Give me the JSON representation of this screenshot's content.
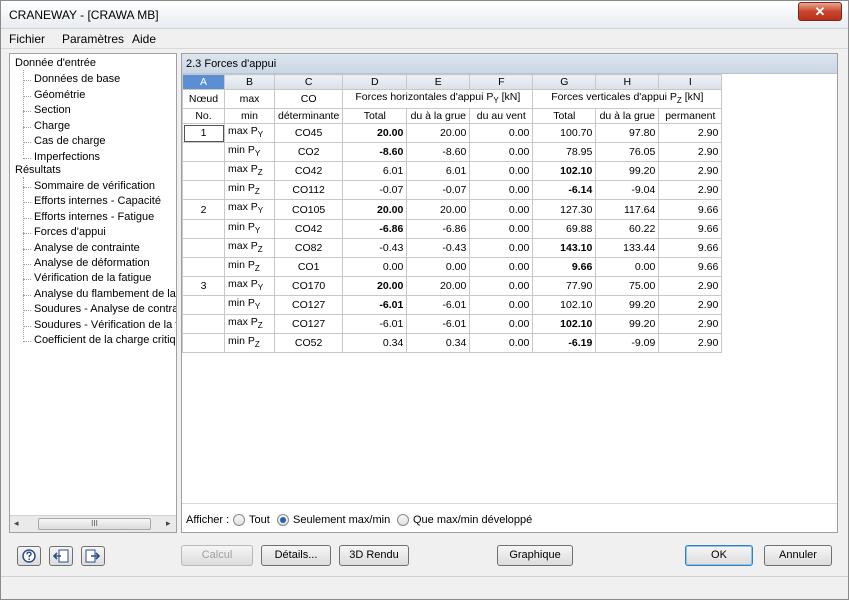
{
  "window": {
    "title": "CRANEWAY - [CRAWA MB]",
    "close_glyph": "✕"
  },
  "menu": [
    "Fichier",
    "Paramètres",
    "Aide"
  ],
  "nav": {
    "input_root": "Donnée d'entrée",
    "input_items": [
      "Données de base",
      "Géométrie",
      "Section",
      "Charge",
      "Cas de charge",
      "Imperfections"
    ],
    "results_root": "Résultats",
    "result_items": [
      "Sommaire de vérification",
      "Efforts internes - Capacité",
      "Efforts internes - Fatigue",
      "Forces d'appui",
      "Analyse de contrainte",
      "Analyse de déformation",
      "Vérification de la fatigue",
      "Analyse du flambement de la pl",
      "Soudures - Analyse de contrain",
      "Soudures - Vérification de la fat",
      "Coefficient de la charge critique"
    ],
    "scroll_left": "◂",
    "scroll_right": "▸",
    "scroll_grip": "III"
  },
  "section": {
    "title": "2.3 Forces d'appui"
  },
  "table": {
    "letters": [
      "A",
      "B",
      "C",
      "D",
      "E",
      "F",
      "G",
      "H",
      "I"
    ],
    "header1": {
      "node": "Nœud",
      "maxmin": "max",
      "co": "CO",
      "horiz": "Forces horizontales d'appui P",
      "horiz_sub": "Y",
      "horiz_unit": " [kN]",
      "vert": "Forces verticales d'appui P",
      "vert_sub": "Z",
      "vert_unit": " [kN]"
    },
    "header2": {
      "node": "No.",
      "maxmin": "min",
      "co": "déterminante",
      "d": "Total",
      "e": "du à la grue",
      "f": "du au vent",
      "g": "Total",
      "h": "du à la grue",
      "i": "permanent"
    },
    "rows": [
      {
        "node": "1",
        "label": "max P",
        "sub": "Y",
        "co": "CO45",
        "d": "20.00",
        "e": "20.00",
        "f": "0.00",
        "g": "100.70",
        "h": "97.80",
        "i": "2.90"
      },
      {
        "node": "",
        "label": "min P",
        "sub": "Y",
        "co": "CO2",
        "d": "-8.60",
        "e": "-8.60",
        "f": "0.00",
        "g": "78.95",
        "h": "76.05",
        "i": "2.90"
      },
      {
        "node": "",
        "label": "max P",
        "sub": "Z",
        "co": "CO42",
        "d": "6.01",
        "e": "6.01",
        "f": "0.00",
        "g": "102.10",
        "h": "99.20",
        "i": "2.90"
      },
      {
        "node": "",
        "label": "min P",
        "sub": "Z",
        "co": "CO112",
        "d": "-0.07",
        "e": "-0.07",
        "f": "0.00",
        "g": "-6.14",
        "h": "-9.04",
        "i": "2.90"
      },
      {
        "node": "2",
        "label": "max P",
        "sub": "Y",
        "co": "CO105",
        "d": "20.00",
        "e": "20.00",
        "f": "0.00",
        "g": "127.30",
        "h": "117.64",
        "i": "9.66"
      },
      {
        "node": "",
        "label": "min P",
        "sub": "Y",
        "co": "CO42",
        "d": "-6.86",
        "e": "-6.86",
        "f": "0.00",
        "g": "69.88",
        "h": "60.22",
        "i": "9.66"
      },
      {
        "node": "",
        "label": "max P",
        "sub": "Z",
        "co": "CO82",
        "d": "-0.43",
        "e": "-0.43",
        "f": "0.00",
        "g": "143.10",
        "h": "133.44",
        "i": "9.66"
      },
      {
        "node": "",
        "label": "min P",
        "sub": "Z",
        "co": "CO1",
        "d": "0.00",
        "e": "0.00",
        "f": "0.00",
        "g": "9.66",
        "h": "0.00",
        "i": "9.66"
      },
      {
        "node": "3",
        "label": "max P",
        "sub": "Y",
        "co": "CO170",
        "d": "20.00",
        "e": "20.00",
        "f": "0.00",
        "g": "77.90",
        "h": "75.00",
        "i": "2.90"
      },
      {
        "node": "",
        "label": "min P",
        "sub": "Y",
        "co": "CO127",
        "d": "-6.01",
        "e": "-6.01",
        "f": "0.00",
        "g": "102.10",
        "h": "99.20",
        "i": "2.90"
      },
      {
        "node": "",
        "label": "max P",
        "sub": "Z",
        "co": "CO127",
        "d": "-6.01",
        "e": "-6.01",
        "f": "0.00",
        "g": "102.10",
        "h": "99.20",
        "i": "2.90"
      },
      {
        "node": "",
        "label": "min P",
        "sub": "Z",
        "co": "CO52",
        "d": "0.34",
        "e": "0.34",
        "f": "0.00",
        "g": "-6.19",
        "h": "-9.09",
        "i": "2.90"
      }
    ]
  },
  "afficher": {
    "label": "Afficher :",
    "options": [
      "Tout",
      "Seulement max/min",
      "Que max/min développé"
    ],
    "selected": "Seulement max/min"
  },
  "buttons": {
    "calcul": "Calcul",
    "details": "Détails...",
    "rendu": "3D Rendu",
    "graphique": "Graphique",
    "ok": "OK",
    "annuler": "Annuler"
  }
}
